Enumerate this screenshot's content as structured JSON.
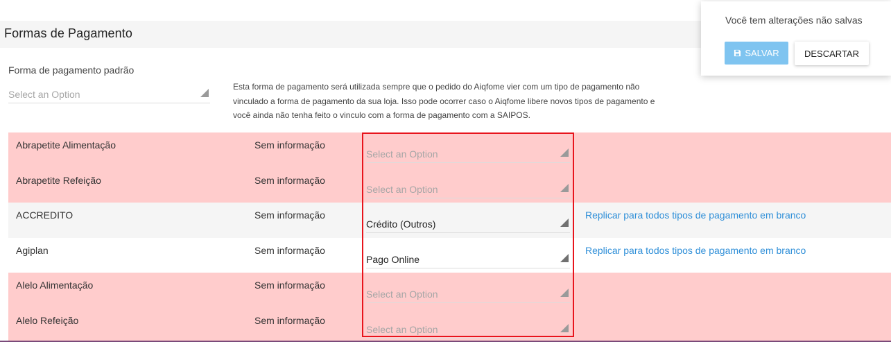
{
  "section": {
    "title": "Formas de Pagamento"
  },
  "default_payment": {
    "label": "Forma de pagamento padrão",
    "select_value": "Select an Option",
    "description": "Esta forma de pagamento será utilizada sempre que o pedido do Aiqfome vier com um tipo de pagamento não vinculado a forma de pagamento da sua loja. Isso pode ocorrer caso o Aiqfome libere novos tipos de pagamento e você ainda não tenha feito o vinculo com a forma de pagamento com a SAIPOS."
  },
  "payment_rows": [
    {
      "name": "Abrapetite Alimentação",
      "info": "Sem informação",
      "selected": "Select an Option",
      "link": ""
    },
    {
      "name": "Abrapetite Refeição",
      "info": "Sem informação",
      "selected": "Select an Option",
      "link": ""
    },
    {
      "name": "ACCREDITO",
      "info": "Sem informação",
      "selected": "Crédito (Outros)",
      "link": "Replicar para todos tipos de pagamento em branco"
    },
    {
      "name": "Agiplan",
      "info": "Sem informação",
      "selected": "Pago Online",
      "link": "Replicar para todos tipos de pagamento em branco"
    },
    {
      "name": "Alelo Alimentação",
      "info": "Sem informação",
      "selected": "Select an Option",
      "link": ""
    },
    {
      "name": "Alelo Refeição",
      "info": "Sem informação",
      "selected": "Select an Option",
      "link": ""
    }
  ],
  "unsaved_panel": {
    "message": "Você tem alterações não salvas",
    "save_label": "SALVAR",
    "discard_label": "DESCARTAR"
  },
  "icons": {
    "save": "floppy-disk-icon",
    "select_arrow": "triangle-corner-icon"
  },
  "colors": {
    "row_unmapped": "#ffcccc",
    "link": "#2f8fd8",
    "save_button": "#7fc4f0",
    "highlight": "#e8141c"
  }
}
